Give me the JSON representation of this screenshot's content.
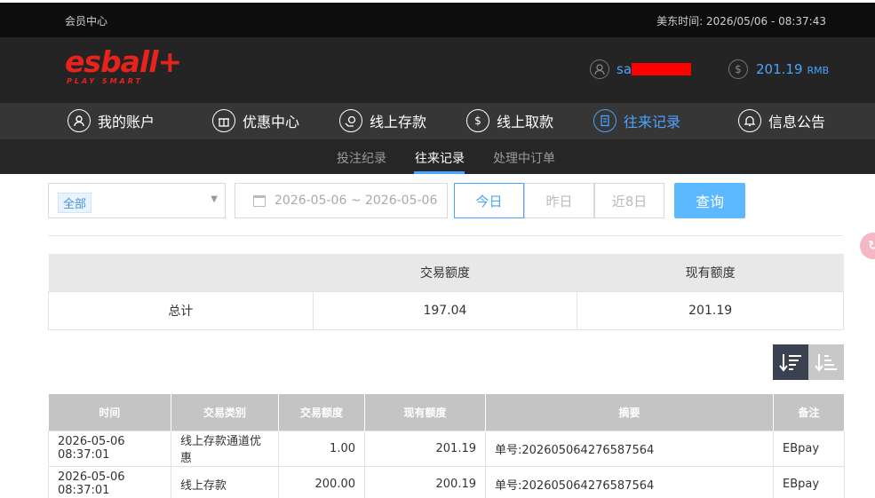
{
  "topbar": {
    "member_center": "会员中心",
    "time": "美东时间: 2026/05/06 - 08:37:43"
  },
  "header": {
    "logo_text": "esball+",
    "logo_tagline": "PLAY SMART",
    "username_prefix": "sa",
    "balance": "201.19",
    "currency": "RMB",
    "accent_color": "#4aa3ff",
    "brand_color": "#e8231c"
  },
  "nav": {
    "items": [
      {
        "label": "我的账户",
        "icon": "user-icon"
      },
      {
        "label": "优惠中心",
        "icon": "gift-icon"
      },
      {
        "label": "线上存款",
        "icon": "deposit-icon"
      },
      {
        "label": "线上取款",
        "icon": "withdraw-icon"
      },
      {
        "label": "往来记录",
        "icon": "records-icon",
        "active": true
      },
      {
        "label": "信息公告",
        "icon": "bell-icon"
      }
    ]
  },
  "subnav": {
    "items": [
      "投注纪录",
      "往来记录",
      "处理中订单"
    ],
    "active": "往来记录"
  },
  "filter": {
    "type_selected": "全部",
    "date_range": "2026-05-06 ~ 2026-05-06",
    "today": "今日",
    "yesterday": "昨日",
    "last8": "近8日",
    "query": "查询"
  },
  "summary": {
    "headers": [
      "",
      "交易额度",
      "现有额度"
    ],
    "row": {
      "label": "总计",
      "amount": "197.04",
      "balance": "201.19"
    }
  },
  "records": {
    "headers": [
      "时间",
      "交易类别",
      "交易额度",
      "现有额度",
      "摘要",
      "备注"
    ],
    "rows": [
      {
        "time": "2026-05-06 08:37:01",
        "type": "线上存款通道优惠",
        "amount": "1.00",
        "balance": "201.19",
        "summary": "单号:202605064276587564",
        "note": "EBpay"
      },
      {
        "time": "2026-05-06 08:37:01",
        "type": "线上存款",
        "amount": "200.00",
        "balance": "200.19",
        "summary": "单号:202605064276587564",
        "note": "EBpay"
      }
    ]
  }
}
